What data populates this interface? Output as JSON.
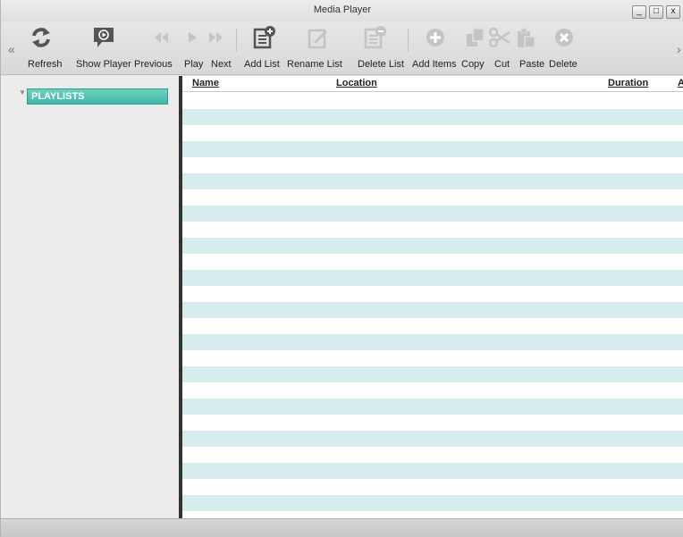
{
  "window": {
    "title": "Media Player"
  },
  "toolbar": {
    "scroll_left": "«",
    "scroll_right": "›",
    "buttons": [
      {
        "id": "refresh",
        "label": "Refresh",
        "icon": "refresh-icon",
        "enabled": true
      },
      {
        "id": "show-player",
        "label": "Show Player",
        "icon": "player-icon",
        "enabled": true
      },
      {
        "id": "previous",
        "label": "Previous",
        "icon": "previous-icon",
        "enabled": false
      },
      {
        "id": "play",
        "label": "Play",
        "icon": "play-icon",
        "enabled": false
      },
      {
        "id": "next",
        "label": "Next",
        "icon": "next-icon",
        "enabled": false
      },
      {
        "id": "add-list",
        "label": "Add List",
        "icon": "add-list-icon",
        "enabled": true
      },
      {
        "id": "rename-list",
        "label": "Rename List",
        "icon": "rename-list-icon",
        "enabled": false
      },
      {
        "id": "delete-list",
        "label": "Delete List",
        "icon": "delete-list-icon",
        "enabled": false
      },
      {
        "id": "add-items",
        "label": "Add Items",
        "icon": "add-items-icon",
        "enabled": false
      },
      {
        "id": "copy",
        "label": "Copy",
        "icon": "copy-icon",
        "enabled": false
      },
      {
        "id": "cut",
        "label": "Cut",
        "icon": "scissors-icon",
        "enabled": false
      },
      {
        "id": "paste",
        "label": "Paste",
        "icon": "paste-icon",
        "enabled": false
      },
      {
        "id": "delete",
        "label": "Delete",
        "icon": "delete-icon",
        "enabled": false
      }
    ]
  },
  "sidebar": {
    "root_label": "PLAYLISTS"
  },
  "table": {
    "columns": [
      "Name",
      "Location",
      "Duration",
      "A"
    ]
  },
  "colors": {
    "accent": "#3fb8a7",
    "row_alt": "#d6ecec",
    "icon_enabled": "#555555",
    "icon_disabled": "#c4c4c4"
  }
}
